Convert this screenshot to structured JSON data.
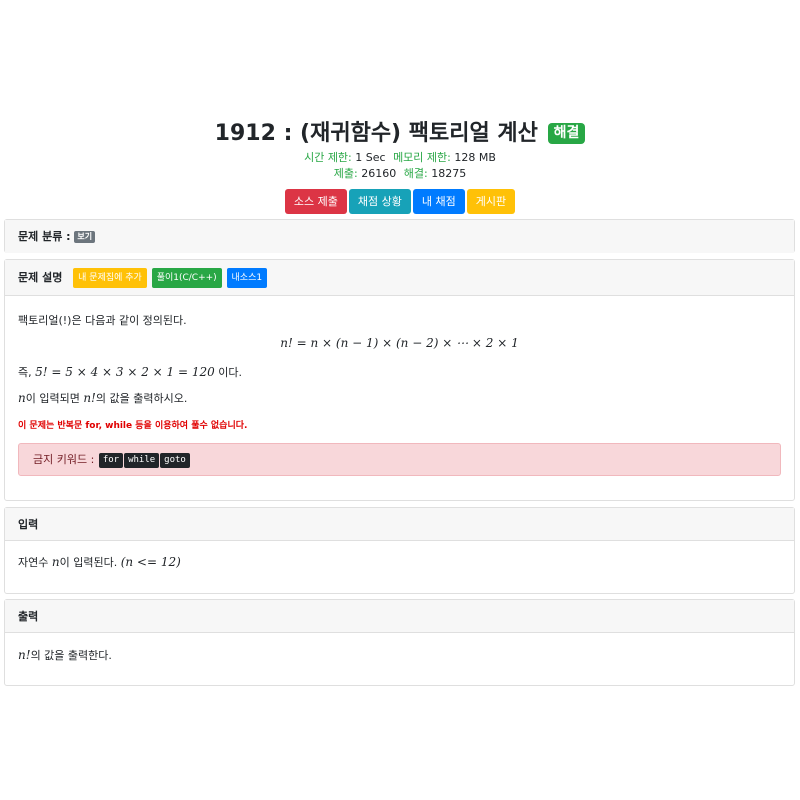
{
  "problem": {
    "number": "1912",
    "separator": ":",
    "title": "(재귀함수) 팩토리얼 계산",
    "status_badge": "해결",
    "time_limit_label": "시간 제한:",
    "time_limit": "1 Sec",
    "memory_limit_label": "메모리 제한:",
    "memory_limit": "128 MB",
    "submissions_label": "제출:",
    "submissions": "26160",
    "solved_label": "해결:",
    "solved": "18275"
  },
  "actions": {
    "submit": "소스 제출",
    "status": "채점 상황",
    "my_status": "내 채점",
    "board": "게시판"
  },
  "category": {
    "heading": "문제 분류 :",
    "show_badge": "보기"
  },
  "description": {
    "heading": "문제 설명",
    "add_to_set": "내 문제집에 추가",
    "solution": "풀이1(C/C++)",
    "my_source": "내소스1",
    "intro": "팩토리얼(!)은 다음과 같이 정의된다.",
    "formula": "n! = n × (n − 1) × (n − 2) × ⋯ × 2 × 1",
    "example_prefix": "즉, ",
    "example_math": "5! = 5 × 4 × 3 × 2 × 1 = 120",
    "example_suffix": " 이다.",
    "task_var": "n",
    "task_mid": "이 입력되면 ",
    "task_expr": "n!",
    "task_suffix": "의 값을 출력하시오.",
    "warning": "이 문제는 반복문 for, while 등을 이용하여 풀수 없습니다.",
    "forbidden_label": "금지 키워드 :",
    "forbidden_keywords": [
      "for",
      "while",
      "goto"
    ]
  },
  "input": {
    "heading": "입력",
    "prefix": "자연수 ",
    "var": "n",
    "middle": "이 입력된다. ",
    "constraint": "(n <= 12)"
  },
  "output": {
    "heading": "출력",
    "expr": "n!",
    "suffix": "의 값을 출력한다."
  },
  "colors": {
    "success": "#28a745",
    "danger": "#dc3545",
    "info": "#17a2b8",
    "primary": "#007bff",
    "warning": "#ffc107",
    "secondary": "#6c757d"
  }
}
